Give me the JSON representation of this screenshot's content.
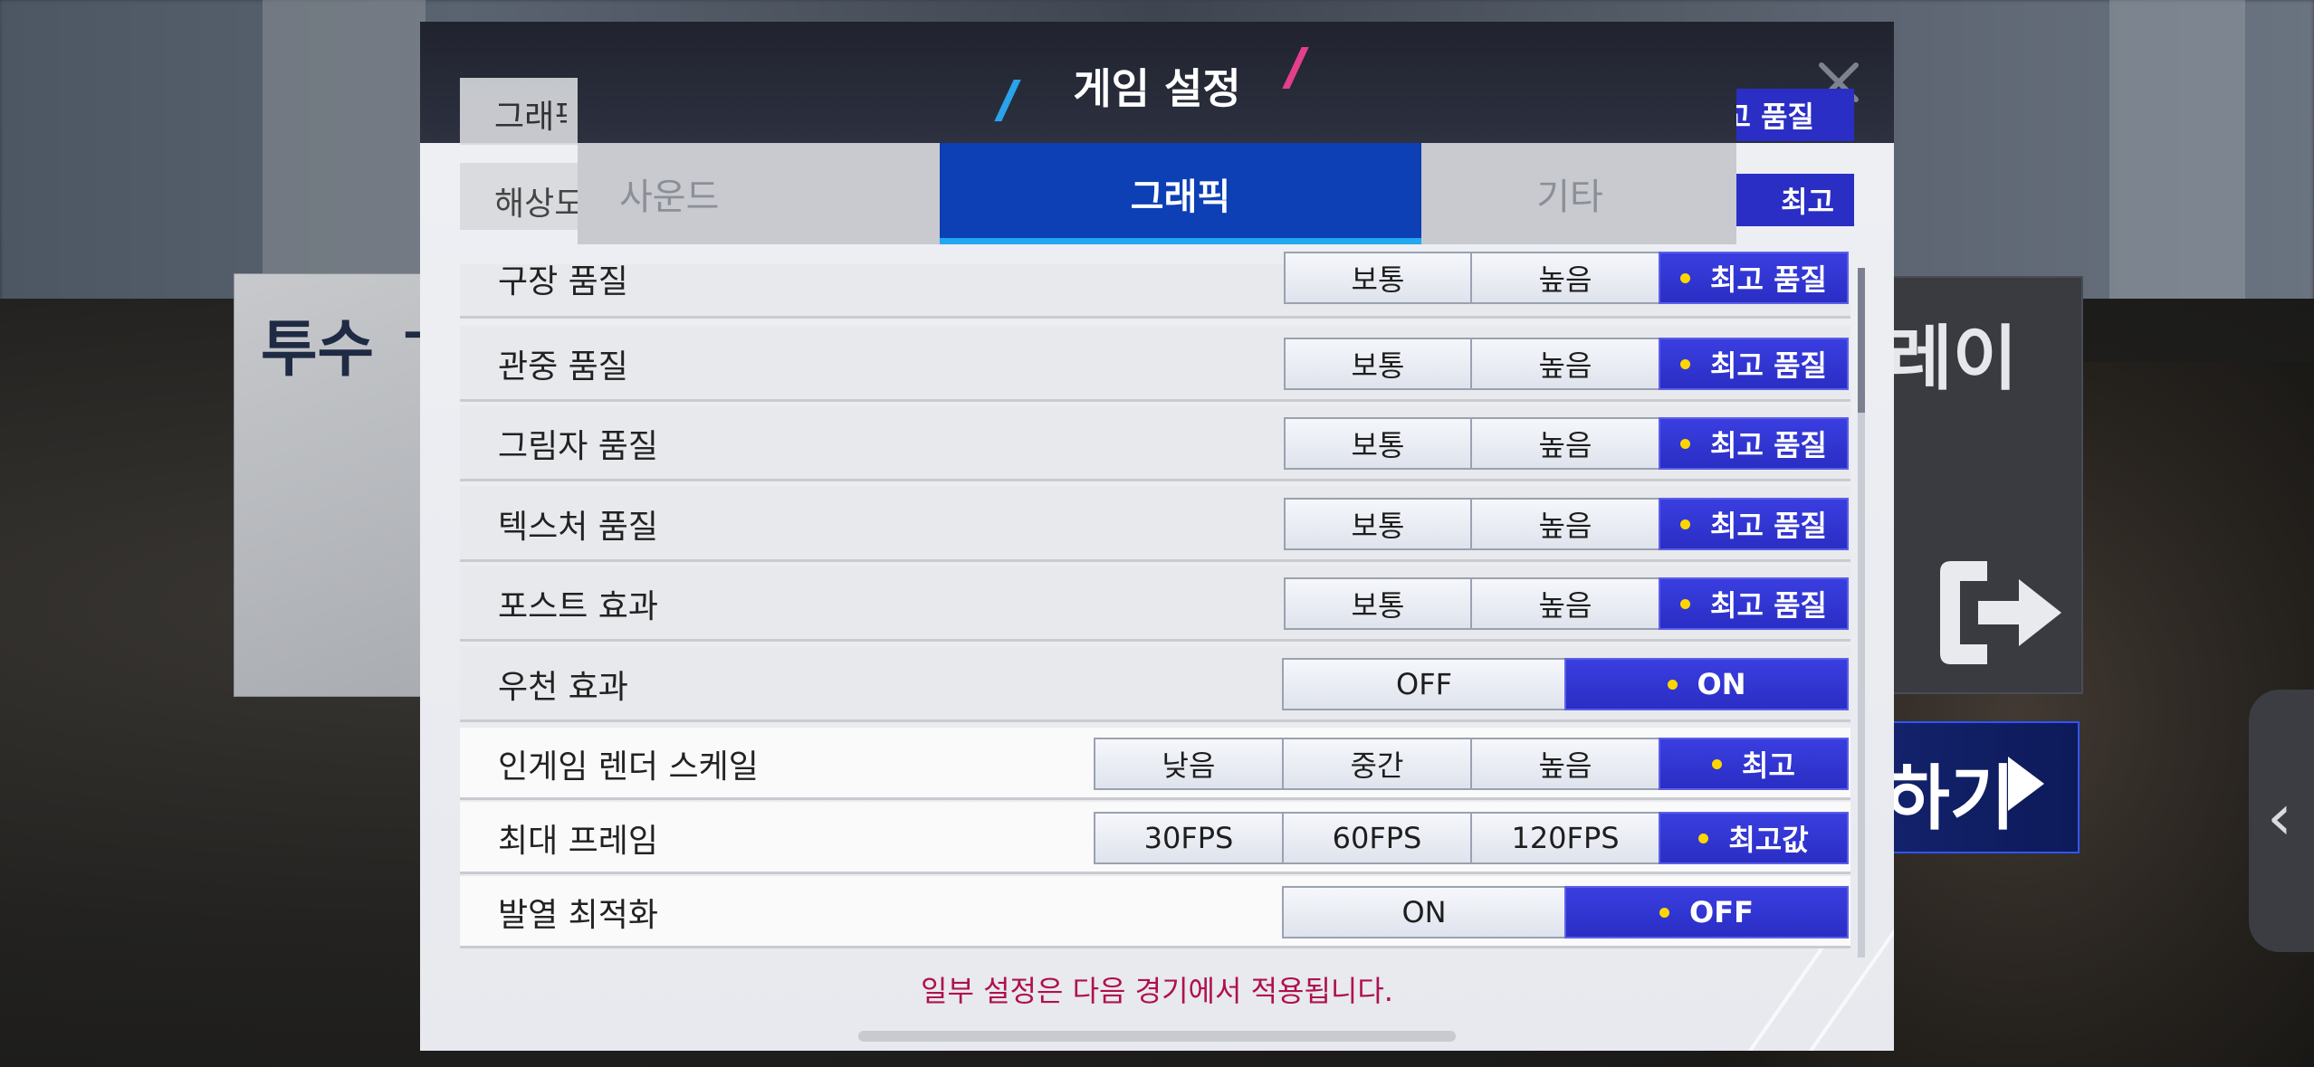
{
  "background": {
    "left_card_title": "투수 ㄱ",
    "right_card_title": "레이",
    "play_button_label": "하기",
    "side_tab_icon": "‹"
  },
  "modal": {
    "title": "게임 설정",
    "tabs": [
      {
        "label": "사운드",
        "active": false
      },
      {
        "label": "그래픽",
        "active": true
      },
      {
        "label": "기타",
        "active": false
      }
    ],
    "ghost_rows": [
      {
        "label": "그래픽",
        "value": "최고 품질"
      },
      {
        "label": "해상도",
        "value": "최고"
      }
    ],
    "settings": [
      {
        "label": "구장 품질",
        "options": [
          "보통",
          "높음",
          "최고 품질"
        ],
        "selected": 2
      },
      {
        "label": "관중 품질",
        "options": [
          "보통",
          "높음",
          "최고 품질"
        ],
        "selected": 2
      },
      {
        "label": "그림자 품질",
        "options": [
          "보통",
          "높음",
          "최고 품질"
        ],
        "selected": 2
      },
      {
        "label": "텍스처 품질",
        "options": [
          "보통",
          "높음",
          "최고 품질"
        ],
        "selected": 2
      },
      {
        "label": "포스트 효과",
        "options": [
          "보통",
          "높음",
          "최고 품질"
        ],
        "selected": 2
      },
      {
        "label": "우천 효과",
        "options": [
          "OFF",
          "ON"
        ],
        "selected": 1
      },
      {
        "label": "인게임 렌더 스케일",
        "options": [
          "낮음",
          "중간",
          "높음",
          "최고"
        ],
        "selected": 3
      },
      {
        "label": "최대 프레임",
        "options": [
          "30FPS",
          "60FPS",
          "120FPS",
          "최고값"
        ],
        "selected": 3
      },
      {
        "label": "발열 최적화",
        "options": [
          "ON",
          "OFF"
        ],
        "selected": 1
      }
    ],
    "notice": "일부 설정은 다음 경기에서 적용됩니다."
  },
  "colors": {
    "selected": "#2a2ec4",
    "active_tab": "#0d3fb5",
    "selected_dot": "#ffd600",
    "notice": "#b0104f"
  }
}
